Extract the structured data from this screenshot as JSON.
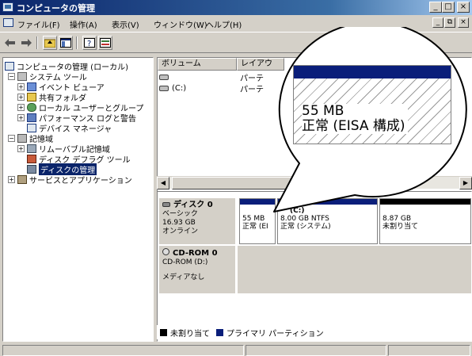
{
  "window": {
    "title": "コンピュータの管理",
    "minimize": "_",
    "maximize": "□",
    "close": "×",
    "mdi_minimize": "_",
    "mdi_restore": "⧉",
    "mdi_close": "×"
  },
  "menu": [
    "ファイル(F)",
    "操作(A)",
    "表示(V)",
    "ウィンドウ(W)",
    "ヘルプ(H)"
  ],
  "toolbar": {
    "icons": [
      "back-arrow-icon",
      "forward-arrow-icon",
      "up-folder-icon",
      "show-hide-tree-icon",
      "help-icon",
      "properties-icon"
    ]
  },
  "tree": {
    "items": [
      {
        "label": "コンピュータの管理 (ローカル)",
        "icon": "computer-management-icon",
        "expander": ""
      },
      {
        "label": "システム ツール",
        "icon": "tools-icon",
        "expander": "−"
      },
      {
        "label": "イベント ビューア",
        "icon": "event-viewer-icon",
        "expander": "+"
      },
      {
        "label": "共有フォルダ",
        "icon": "shared-folder-icon",
        "expander": "+"
      },
      {
        "label": "ローカル ユーザーとグループ",
        "icon": "users-icon",
        "expander": "+"
      },
      {
        "label": "パフォーマンス ログと警告",
        "icon": "performance-icon",
        "expander": "+"
      },
      {
        "label": "デバイス マネージャ",
        "icon": "device-manager-icon",
        "expander": ""
      },
      {
        "label": "記憶域",
        "icon": "storage-icon",
        "expander": "−"
      },
      {
        "label": "リムーバブル記憶域",
        "icon": "removable-storage-icon",
        "expander": "+"
      },
      {
        "label": "ディスク デフラグ ツール",
        "icon": "defrag-icon",
        "expander": ""
      },
      {
        "label": "ディスクの管理",
        "icon": "disk-management-icon",
        "expander": ""
      },
      {
        "label": "サービスとアプリケーション",
        "icon": "services-icon",
        "expander": "+"
      }
    ]
  },
  "volume_list": {
    "headers": [
      "ボリューム",
      "レイアウ"
    ],
    "rows": [
      {
        "volume": "",
        "layout": "パーテ"
      },
      {
        "volume": "(C:)",
        "layout": "パーテ"
      }
    ]
  },
  "disks": [
    {
      "name": "ディスク 0",
      "type": "ベーシック",
      "size": "16.93 GB",
      "status": "オンライン",
      "partitions": [
        {
          "label": "",
          "size": "55 MB",
          "status": "正常 (EI"
        },
        {
          "label": "(C:)",
          "size": "8.00 GB NTFS",
          "status": "正常 (システム)"
        },
        {
          "label": "",
          "size": "8.87 GB",
          "status": "未割り当て"
        }
      ]
    },
    {
      "name": "CD-ROM 0",
      "type": "CD-ROM (D:)",
      "status": "メディアなし"
    }
  ],
  "legend": [
    {
      "label": "未割り当て",
      "color": "#000000"
    },
    {
      "label": "プライマリ パーティション",
      "color": "#0a1e7a"
    }
  ],
  "callout": {
    "size": "55 MB",
    "status": "正常 (EISA 構成)"
  },
  "colors": {
    "title_start": "#0a246a",
    "selection": "#0a246a",
    "primary_partition": "#0a1e7a",
    "chrome": "#d4d0c8"
  }
}
